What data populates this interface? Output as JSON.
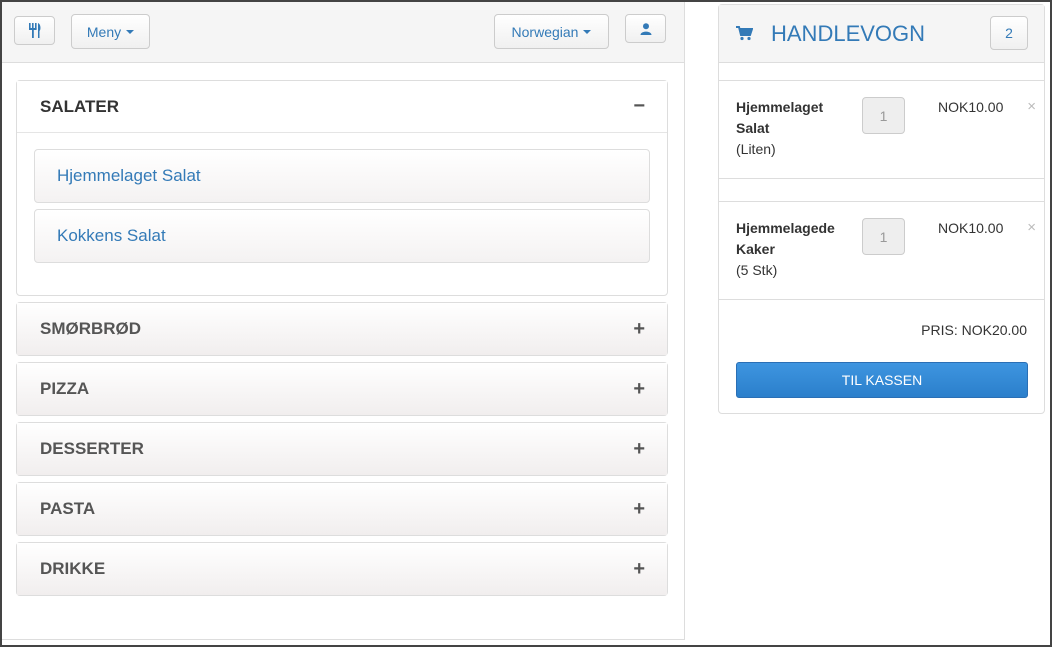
{
  "topbar": {
    "restaurant_icon": "fork-knife-icon",
    "menu_label": "Meny",
    "language_label": "Norwegian",
    "user_icon": "user-icon"
  },
  "categories": [
    {
      "label": "SALATER",
      "toggle": "−",
      "open": true,
      "items": [
        {
          "label": "Hjemmelaget Salat"
        },
        {
          "label": "Kokkens Salat"
        }
      ]
    },
    {
      "label": "SMØRBRØD",
      "toggle": "+",
      "open": false
    },
    {
      "label": "PIZZA",
      "toggle": "+",
      "open": false
    },
    {
      "label": "DESSERTER",
      "toggle": "+",
      "open": false
    },
    {
      "label": "PASTA",
      "toggle": "+",
      "open": false
    },
    {
      "label": "DRIKKE",
      "toggle": "+",
      "open": false
    }
  ],
  "cart": {
    "icon": "shopping-cart-icon",
    "title": "HANDLEVOGN",
    "count": "2",
    "items": [
      {
        "name_line1": "Hjemmelaget",
        "name_line2": "Salat",
        "variant": "(Liten)",
        "qty": "1",
        "price": "NOK10.00",
        "remove": "×"
      },
      {
        "name_line1": "Hjemmelagede",
        "name_line2": "Kaker",
        "variant": "(5 Stk)",
        "qty": "1",
        "price": "NOK10.00",
        "remove": "×"
      }
    ],
    "total": "PRIS: NOK20.00",
    "checkout_label": "TIL KASSEN"
  },
  "colors": {
    "accent": "#337ab7",
    "checkout": "#2f86d4"
  }
}
